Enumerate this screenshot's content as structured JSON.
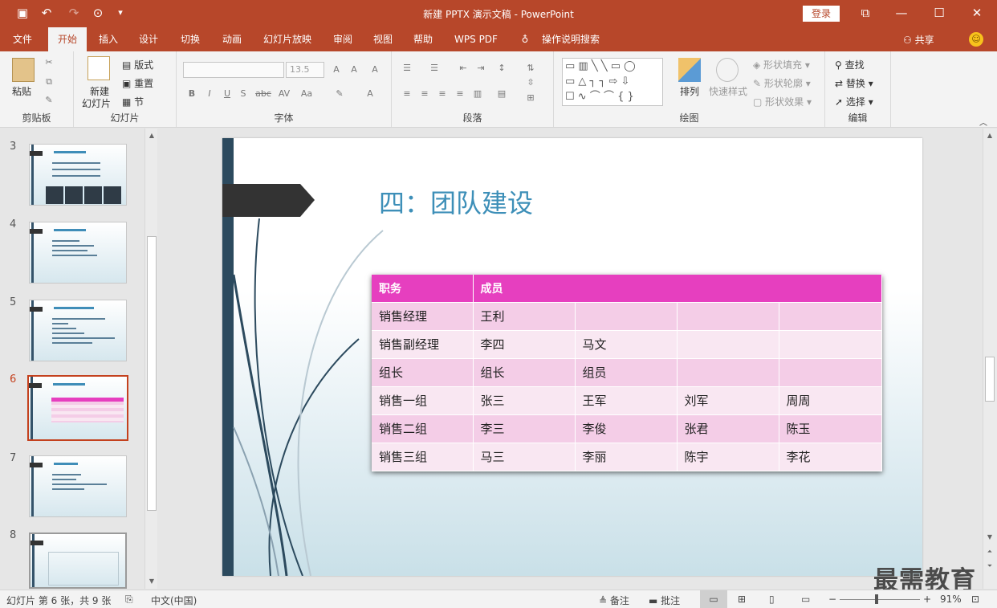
{
  "titlebar": {
    "title": "新建 PPTX 演示文稿 - PowerPoint",
    "login": "登录",
    "qat": {
      "save_icon": "💾",
      "undo": "↶",
      "redo": "↷",
      "start": "⊙",
      "more": "▾"
    },
    "win": {
      "ribbon_display": "⧉",
      "minimize": "—",
      "maximize": "☐",
      "close": "✕"
    }
  },
  "tabs": [
    "文件",
    "开始",
    "插入",
    "设计",
    "切换",
    "动画",
    "幻灯片放映",
    "审阅",
    "视图",
    "帮助",
    "WPS PDF",
    "操作说明搜索"
  ],
  "active_tab": "开始",
  "share": "共享",
  "ribbon": {
    "clipboard": {
      "label": "剪贴板",
      "paste": "粘贴"
    },
    "slides": {
      "label": "幻灯片",
      "new_slide_1": "新建",
      "new_slide_2": "幻灯片",
      "layout": "版式",
      "reset": "重置",
      "section": "节"
    },
    "font": {
      "label": "字体",
      "size": "13.5"
    },
    "paragraph": {
      "label": "段落"
    },
    "drawing": {
      "label": "绘图",
      "arrange": "排列",
      "quick_styles": "快速样式",
      "shape_fill": "形状填充",
      "shape_outline": "形状轮廓",
      "shape_effects": "形状效果"
    },
    "editing": {
      "label": "编辑",
      "find": "查找",
      "replace": "替换",
      "select": "选择"
    }
  },
  "thumbnails": [
    {
      "num": "3"
    },
    {
      "num": "4"
    },
    {
      "num": "5"
    },
    {
      "num": "6",
      "active": true
    },
    {
      "num": "7"
    },
    {
      "num": "8"
    }
  ],
  "slide": {
    "title": "四：团队建设",
    "table": {
      "header": [
        "职务",
        "成员"
      ],
      "rows": [
        [
          "销售经理",
          "王利",
          "",
          "",
          ""
        ],
        [
          "销售副经理",
          "李四",
          "马文",
          "",
          ""
        ],
        [
          "组长",
          "组长",
          "组员",
          "",
          ""
        ],
        [
          "销售一组",
          "张三",
          "王军",
          "刘军",
          "周周"
        ],
        [
          "销售二组",
          "李三",
          "李俊",
          "张君",
          "陈玉"
        ],
        [
          "销售三组",
          "马三",
          "李丽",
          "陈宇",
          "李花"
        ]
      ]
    }
  },
  "watermark": "最需教育",
  "status": {
    "slide_info": "幻灯片 第 6 张，共 9 张",
    "language": "中文(中国)",
    "notes": "备注",
    "comments": "批注",
    "zoom": "91%"
  },
  "colors": {
    "accent": "#b7472a",
    "table_header": "#e63fbf",
    "title": "#3d8fb8"
  }
}
